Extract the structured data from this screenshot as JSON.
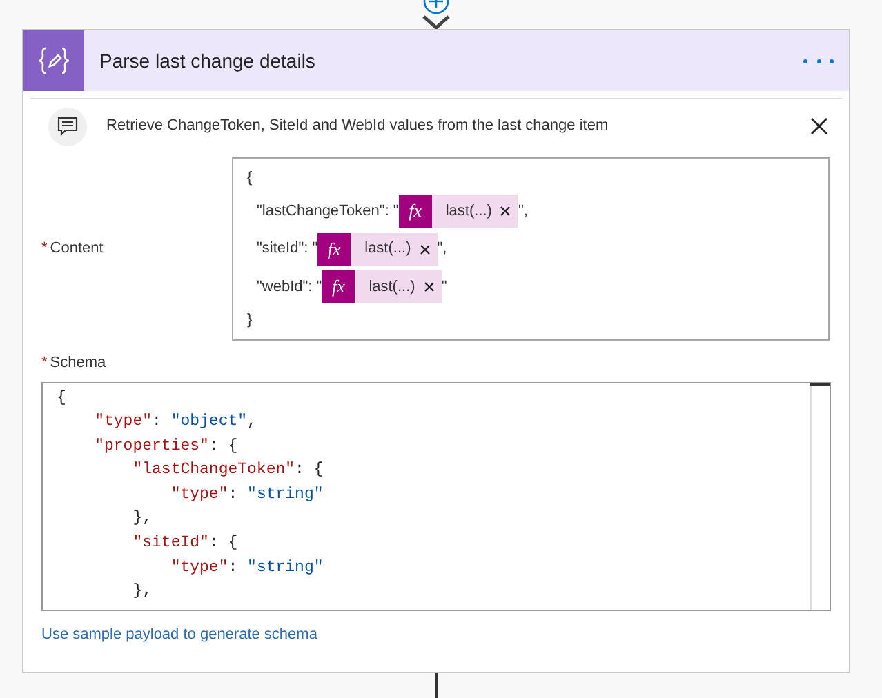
{
  "step": {
    "title": "Parse last change details",
    "comment": "Retrieve ChangeToken, SiteId and WebId values from the last change item"
  },
  "content": {
    "label": "Content",
    "required_mark": "*",
    "open_brace": "{",
    "close_brace": "}",
    "rows": [
      {
        "prefix": "\"lastChangeToken\": \"",
        "token_icon": "fx",
        "token": "last(...)",
        "suffix": "\","
      },
      {
        "prefix": "\"siteId\": \"",
        "token_icon": "fx",
        "token": "last(...)",
        "suffix": "\","
      },
      {
        "prefix": "\"webId\": \"",
        "token_icon": "fx",
        "token": "last(...)",
        "suffix": "\""
      }
    ]
  },
  "schema": {
    "label": "Schema",
    "required_mark": "*",
    "lines": [
      [
        {
          "kind": "punct",
          "text": "{"
        }
      ],
      [
        {
          "kind": "key",
          "text": "    \"type\""
        },
        {
          "kind": "punct",
          "text": ": "
        },
        {
          "kind": "string",
          "text": "\"object\""
        },
        {
          "kind": "punct",
          "text": ","
        }
      ],
      [
        {
          "kind": "key",
          "text": "    \"properties\""
        },
        {
          "kind": "punct",
          "text": ": {"
        }
      ],
      [
        {
          "kind": "key",
          "text": "        \"lastChangeToken\""
        },
        {
          "kind": "punct",
          "text": ": {"
        }
      ],
      [
        {
          "kind": "key",
          "text": "            \"type\""
        },
        {
          "kind": "punct",
          "text": ": "
        },
        {
          "kind": "string",
          "text": "\"string\""
        }
      ],
      [
        {
          "kind": "punct",
          "text": "        },"
        }
      ],
      [
        {
          "kind": "key",
          "text": "        \"siteId\""
        },
        {
          "kind": "punct",
          "text": ": {"
        }
      ],
      [
        {
          "kind": "key",
          "text": "            \"type\""
        },
        {
          "kind": "punct",
          "text": ": "
        },
        {
          "kind": "string",
          "text": "\"string\""
        }
      ],
      [
        {
          "kind": "punct",
          "text": "        },"
        }
      ]
    ],
    "link": "Use sample payload to generate schema"
  }
}
